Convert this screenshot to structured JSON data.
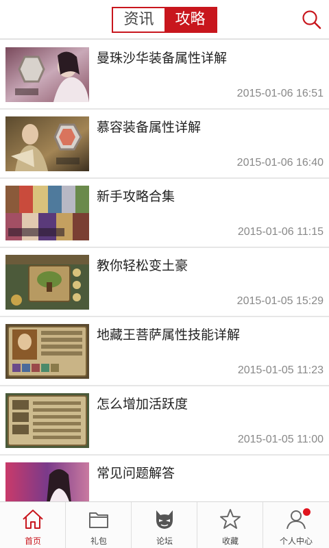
{
  "header": {
    "tabs": [
      {
        "label": "资讯",
        "active": false
      },
      {
        "label": "攻略",
        "active": true
      }
    ],
    "search_icon": "search-icon",
    "accent_color": "#c8161d"
  },
  "articles": [
    {
      "title": "曼珠沙华装备属性详解",
      "time": "2015-01-06 16:51"
    },
    {
      "title": "慕容装备属性详解",
      "time": "2015-01-06 16:40"
    },
    {
      "title": "新手攻略合集",
      "time": "2015-01-06 11:15"
    },
    {
      "title": "教你轻松变土豪",
      "time": "2015-01-05 15:29"
    },
    {
      "title": "地藏王菩萨属性技能详解",
      "time": "2015-01-05 11:23"
    },
    {
      "title": "怎么增加活跃度",
      "time": "2015-01-05 11:00"
    },
    {
      "title": "常见问题解答",
      "time": ""
    }
  ],
  "tabbar": {
    "items": [
      {
        "label": "首页",
        "icon": "home-icon",
        "active": true
      },
      {
        "label": "礼包",
        "icon": "folder-icon",
        "active": false
      },
      {
        "label": "论坛",
        "icon": "forum-mask-icon",
        "active": false
      },
      {
        "label": "收藏",
        "icon": "star-icon",
        "active": false
      },
      {
        "label": "个人中心",
        "icon": "user-icon",
        "active": false,
        "notification_dot": true
      }
    ]
  }
}
